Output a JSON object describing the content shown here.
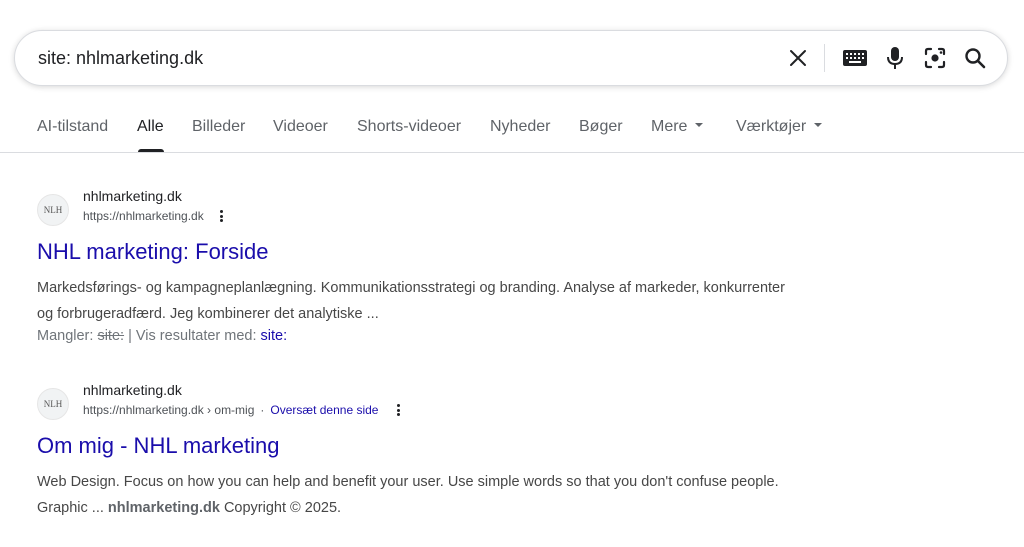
{
  "search": {
    "query": "site: nhlmarketing.dk"
  },
  "icons": {
    "clear": "close-icon",
    "keyboard": "keyboard-icon",
    "voice": "microphone-icon",
    "lens": "camera-lens-icon",
    "search": "search-icon"
  },
  "tabs": [
    {
      "label": "AI-tilstand"
    },
    {
      "label": "Alle",
      "active": true
    },
    {
      "label": "Billeder"
    },
    {
      "label": "Videoer"
    },
    {
      "label": "Shorts-videoer"
    },
    {
      "label": "Nyheder"
    },
    {
      "label": "Bøger"
    },
    {
      "label": "Mere"
    },
    {
      "label": "Værktøjer"
    }
  ],
  "results": [
    {
      "favicon_text": "NLH",
      "site_name": "nhlmarketing.dk",
      "url": "https://nhlmarketing.dk",
      "title": "NHL marketing: Forside",
      "snippet": "Markedsførings- og kampagneplanlægning. Kommunikationsstrategi og branding. Analyse af markeder, konkurrenter og forbrugeradfærd. Jeg kombinerer det analytiske ...",
      "missing_label": "Mangler:",
      "missing_term": "site:",
      "separator": "|",
      "show_with_label": "Vis resultater med:",
      "show_with_term": "site:"
    },
    {
      "favicon_text": "NLH",
      "site_name": "nhlmarketing.dk",
      "url": "https://nhlmarketing.dk › om-mig",
      "url_separator": "·",
      "translate_label": "Oversæt denne side",
      "title": "Om mig - NHL marketing",
      "snippet_part1": "Web Design. Focus on how you can help and benefit your user. Use simple words so that you don't confuse people. Graphic ... ",
      "snippet_bold": "nhlmarketing.dk",
      "snippet_part2": " Copyright © 2025."
    }
  ],
  "colors": {
    "link": "#1a0dab",
    "text": "#202124",
    "secondary": "#5f6368",
    "border": "#dadce0"
  }
}
